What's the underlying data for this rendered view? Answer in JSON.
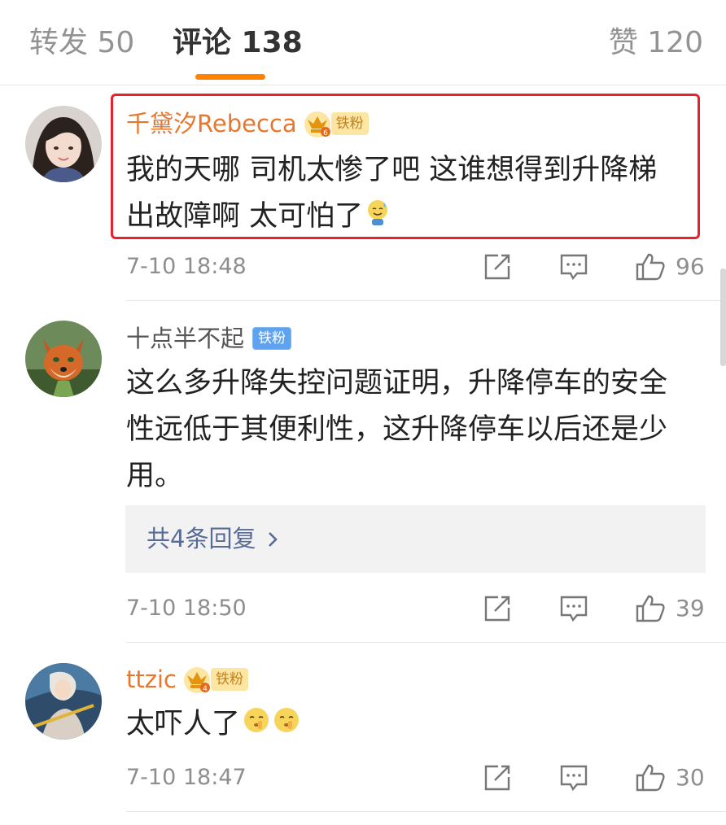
{
  "tabs": {
    "repost": "转发 50",
    "comments": "评论 138",
    "likes": "赞 120"
  },
  "colors": {
    "accent": "#ff8200",
    "highlight": "#e8212b",
    "link": "#576b95",
    "vip_name": "#e8772c"
  },
  "comments": [
    {
      "username": "千黛汐Rebecca",
      "crown_level": "6",
      "badge": "铁粉",
      "text_line1": "我的天哪 司机太惨了吧 这谁想得到升降梯",
      "text_line2": "出故障啊 太可怕了",
      "emoji": "sweat-smile-emoji",
      "time": "7-10 18:48",
      "likes": "96",
      "highlighted": true
    },
    {
      "username": "十点半不起",
      "badge": "铁粉",
      "text_line1": "这么多升降失控问题证明，升降停车的安全",
      "text_line2": "性远低于其便利性，这升降停车以后还是少",
      "text_line3": "用。",
      "replies": "共4条回复",
      "time": "7-10 18:50",
      "likes": "39"
    },
    {
      "username": "ttzic",
      "crown_level": "4",
      "badge": "铁粉",
      "text_line1": "太吓人了",
      "emoji": "shush-emoji",
      "time": "7-10 18:47",
      "likes": "30"
    }
  ],
  "icons": [
    "crown-icon",
    "share-icon",
    "comment-icon",
    "like-icon",
    "chevron-right-icon"
  ]
}
